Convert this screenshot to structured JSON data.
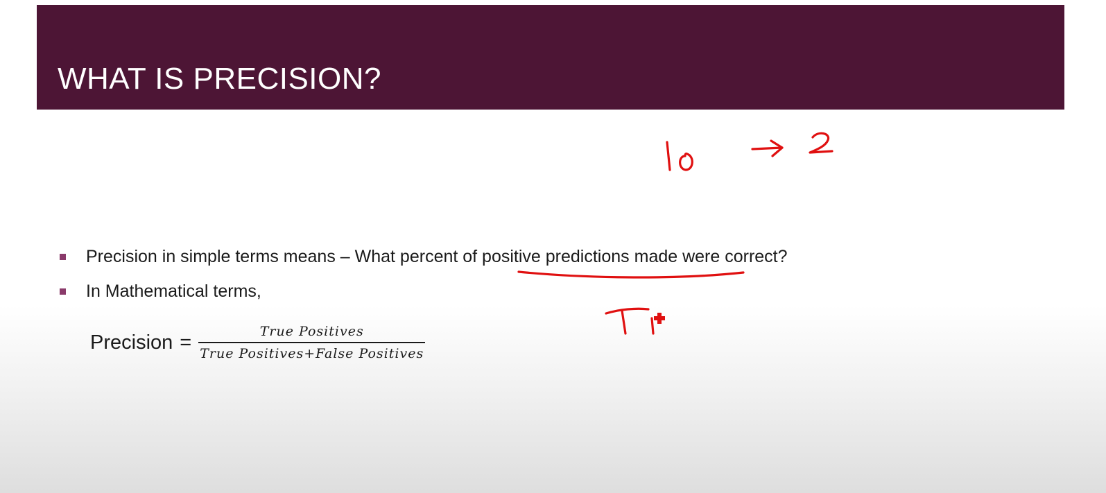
{
  "slide": {
    "title": "WHAT IS PRECISION?",
    "bullets": [
      "Precision in simple terms means – What percent of positive predictions made were correct?",
      "In Mathematical terms,"
    ],
    "formula": {
      "label": "Precision",
      "equals": "=",
      "numerator": "True Positives",
      "denominator": "True Positives+False Positives"
    }
  },
  "annotations": {
    "ink_color": "#e01010",
    "handwritten_note": "10 → 2",
    "handwritten_partial": "T",
    "underlined_phrase": "positive predictions made",
    "cursor_icon": "red-crosshair-cursor"
  },
  "colors": {
    "title_bar": "#4d1535",
    "title_text": "#ffffff",
    "bullet_marker": "#8a3a6a",
    "body_text": "#1a1a1a"
  }
}
